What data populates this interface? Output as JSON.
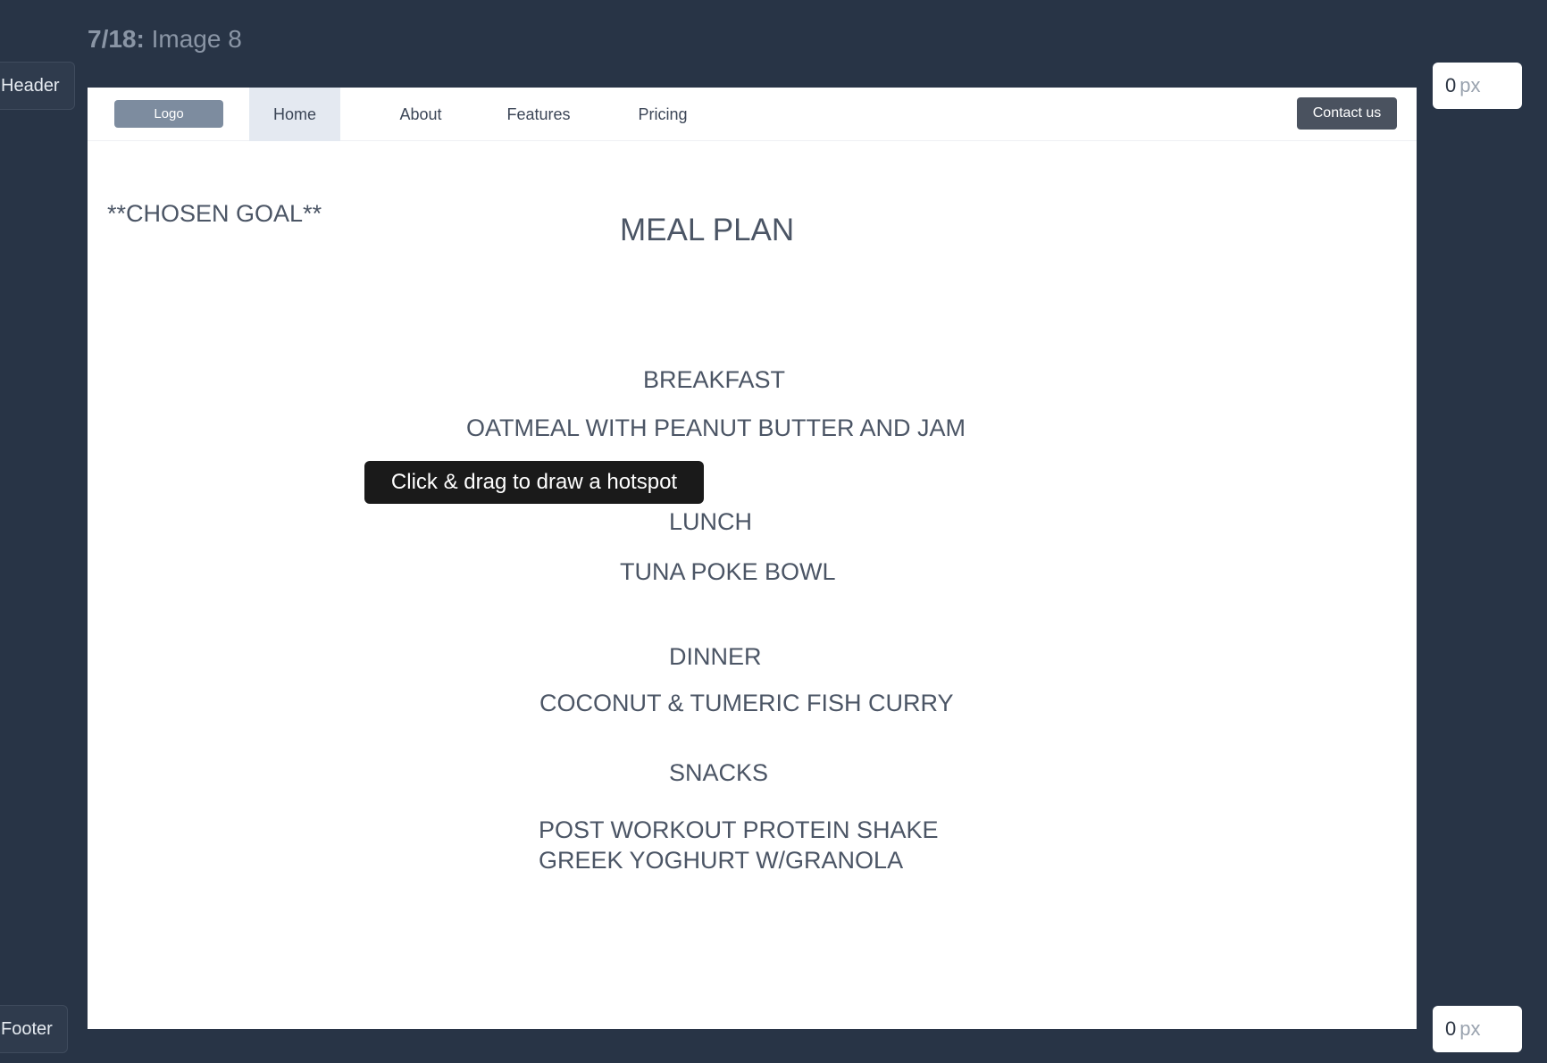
{
  "top": {
    "counter": "7/18:",
    "image_name": "Image 8"
  },
  "side_tabs": {
    "header": "Header",
    "footer": "Footer"
  },
  "px_inputs": {
    "top_value": "0",
    "bottom_value": "0",
    "unit": "px"
  },
  "nav": {
    "logo": "Logo",
    "items": [
      {
        "label": "Home",
        "active": true
      },
      {
        "label": "About"
      },
      {
        "label": "Features"
      },
      {
        "label": "Pricing"
      }
    ],
    "contact": "Contact us"
  },
  "content": {
    "goal": "**CHOSEN GOAL**",
    "title": "MEAL PLAN",
    "breakfast_heading": "BREAKFAST",
    "breakfast_item": "OATMEAL WITH PEANUT BUTTER AND JAM",
    "lunch_heading": "LUNCH",
    "lunch_item": "TUNA POKE BOWL",
    "dinner_heading": "DINNER",
    "dinner_item": "COCONUT & TUMERIC FISH CURRY",
    "snacks_heading": "SNACKS",
    "snack_items": [
      "POST WORKOUT PROTEIN SHAKE",
      "GREEK YOGHURT W/GRANOLA"
    ]
  },
  "tooltip": "Click & drag to draw a hotspot"
}
